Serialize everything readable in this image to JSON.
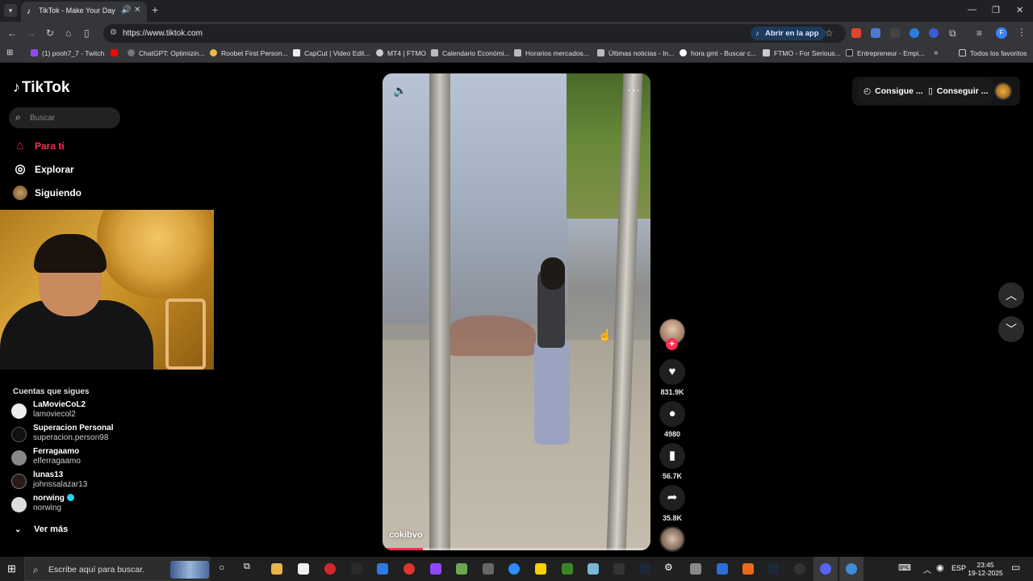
{
  "browser": {
    "tab": {
      "title": "TikTok - Make Your Day"
    },
    "url": "https://www.tiktok.com",
    "open_app_label": "Abrir en la app",
    "bookmarks": [
      "(1) pooh7_7 - Twitch",
      "ChatGPT: Optimizin...",
      "Roobet First Person...",
      "CapCut | Video Edit...",
      "MT4 | FTMO",
      "Calendario Económi...",
      "Horarios mercados...",
      "Últimas noticias - In...",
      "hora gmt - Buscar c...",
      "FTMO - For Serious...",
      "Entrepreneur - Empi..."
    ],
    "all_bookmarks_label": "Todos los favoritos",
    "profile_initial": "F"
  },
  "tiktok": {
    "logo_text": "TikTok",
    "search_placeholder": "Buscar",
    "nav": [
      {
        "label": "Para ti",
        "icon": "home-icon",
        "active": true
      },
      {
        "label": "Explorar",
        "icon": "compass-icon",
        "active": false
      },
      {
        "label": "Siguiendo",
        "icon": "avatar-icon",
        "active": false
      }
    ],
    "following_title": "Cuentas que sigues",
    "following": [
      {
        "name": "LaMovieCoL2",
        "username": "lamoviecol2",
        "verified": false
      },
      {
        "name": "Superacion Personal",
        "username": "superacion.person98",
        "verified": false
      },
      {
        "name": "Ferragaamo",
        "username": "elferragaamo",
        "verified": false
      },
      {
        "name": "lunas13",
        "username": "johnssalazar13",
        "verified": false
      },
      {
        "name": "norwing",
        "username": "norwing",
        "verified": true
      }
    ],
    "see_more": "Ver más",
    "video": {
      "author": "cokibvo",
      "progress": 0.15,
      "likes": "831.9K",
      "comments": "4980",
      "saves": "56.7K",
      "shares": "35.8K"
    },
    "top_right": {
      "coins_label": "Consigue ...",
      "app_label": "Conseguir ..."
    }
  },
  "taskbar": {
    "search_placeholder": "Escribe aquí para buscar.",
    "language": "ESP",
    "time": "23:45",
    "date": "19-12-2025"
  },
  "colors": {
    "accent": "#fe2c55",
    "verified": "#20d5ec"
  }
}
